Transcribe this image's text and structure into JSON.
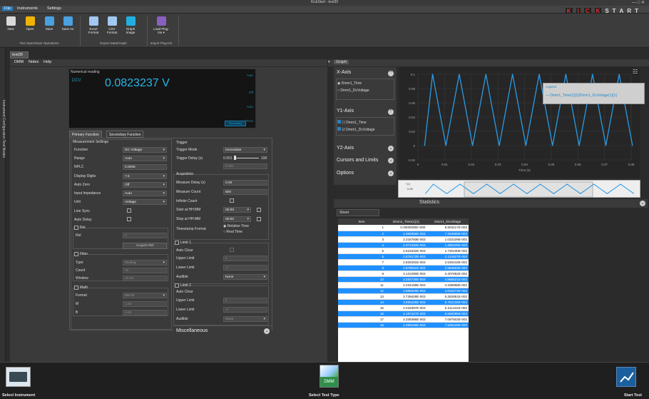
{
  "window": {
    "title": "KickStart - test30"
  },
  "menu": {
    "file": "File",
    "instruments": "Instruments",
    "settings": "Settings"
  },
  "logo": [
    "K",
    "I",
    "C",
    "K",
    "S",
    "T",
    "A",
    "R",
    "T"
  ],
  "ribbon": {
    "buttons": [
      {
        "label": "New",
        "color": "#d9d9d9"
      },
      {
        "label": "Open",
        "color": "#f0b400"
      },
      {
        "label": "Save",
        "color": "#4aa0e0"
      },
      {
        "label": "Save As",
        "color": "#4aa0e0"
      },
      {
        "label": "Excel Format",
        "color": "#a0c8f0"
      },
      {
        "label": "CSV Format",
        "color": "#a0c8f0"
      },
      {
        "label": "Graph Image",
        "color": "#20b0e0"
      },
      {
        "label": "Load Plug-Ins ▾",
        "color": "#8a5fc0"
      }
    ],
    "groups": {
      "file": "Test Open/Save Operations",
      "export": "Export Data/Graph",
      "import": "Import Plug-Ins"
    }
  },
  "side_tab": "Instrument Configuration  Test Nodes",
  "doc_tab": "test30",
  "submenu": {
    "dmm": "DMM",
    "notes": "Notes",
    "help": "Help"
  },
  "graph_tab": "Graph",
  "numerical": {
    "title": "Numerical reading",
    "func": "DCV",
    "value": "0.0823237 V",
    "labels": [
      "Auto",
      "Off",
      "Auto",
      "Trms"
    ],
    "button": "Secondary"
  },
  "tabs": {
    "primary": "Primary Function",
    "secondary": "Secondary Function"
  },
  "meas": {
    "title": "Measurement Settings",
    "function": {
      "label": "Function",
      "value": "DC Voltage"
    },
    "range": {
      "label": "Range",
      "value": "Auto"
    },
    "nplc": {
      "label": "NPLC",
      "value": "0.0005"
    },
    "digits": {
      "label": "Display Digits",
      "value": "7.5"
    },
    "autozero": {
      "label": "Auto Zero",
      "value": "Off"
    },
    "impedance": {
      "label": "Input Impedance",
      "value": "Auto"
    },
    "unit": {
      "label": "Unit",
      "value": "Voltage"
    },
    "linesync": "Line Sync",
    "autodelay": "Auto Delay",
    "rel": "Rel",
    "relfield": {
      "label": "Rel",
      "value": "0"
    },
    "acquire": "Acquire Rel",
    "filter": "Filter",
    "ftype": {
      "label": "Type",
      "value": "Moving"
    },
    "count": {
      "label": "Count",
      "value": "10"
    },
    "window": {
      "label": "Window",
      "value": "10.00"
    },
    "math": "Math",
    "format": {
      "label": "Format",
      "value": "MX+B"
    },
    "m": {
      "label": "M",
      "value": "1.00"
    },
    "b": {
      "label": "B",
      "value": "0.00"
    }
  },
  "trigger": {
    "title": "Trigger",
    "mode": {
      "label": "Trigger Mode",
      "value": "Immediate"
    },
    "delay": {
      "label": "Trigger Delay (s)",
      "value": "0.001",
      "max": "100",
      "box": "0.001"
    },
    "acq": "Acquisition",
    "measdelay": {
      "label": "Measure Delay (s)",
      "value": "0.00"
    },
    "count": {
      "label": "Measure Count",
      "value": "500"
    },
    "infinite": "Infinite Count",
    "start": {
      "label": "Start at HH:MM",
      "value": "00:00"
    },
    "stop": {
      "label": "Stop at HH:MM",
      "value": "00:00"
    },
    "tsformat": "Timestamp Format",
    "rel": "Relative Time",
    "real": "Real Time",
    "limit1": "Limit 1",
    "autoclear": "Auto Clear",
    "upper": {
      "label": "Upper Limit",
      "value": "1"
    },
    "lower": {
      "label": "Lower Limit",
      "value": "-1"
    },
    "audible": {
      "label": "Audible",
      "value": "None"
    },
    "limit2": "Limit 2",
    "autoclear2": "Auto Clear",
    "upper2": {
      "label": "Upper Limit",
      "value": "1"
    },
    "lower2": {
      "label": "Lower Limit",
      "value": "-1"
    },
    "audible2": {
      "label": "Audible",
      "value": "None"
    },
    "misc": "Miscellaneous"
  },
  "graph_side": {
    "xaxis": "X-Axis",
    "xopt1": "Dmm1_Time",
    "xopt2": "Dmm1_DcVoltage",
    "y1": "Y1-Axis",
    "y1opt1": "Dmm1_Time",
    "y1opt2": "Dmm1_DcVoltage",
    "y2": "Y2-Axis",
    "cursors": "Cursors and Limits",
    "options": "Options"
  },
  "legend": {
    "title": "Legend",
    "entry": "— Dmm1_Time(1)[1]/Dmm1_DcVoltage(1)[1]"
  },
  "chart_data": {
    "type": "line",
    "xlabel": "Time (s)",
    "ylabel": "",
    "xlim": [
      0,
      0.08
    ],
    "ylim": [
      -0.02,
      0.1
    ],
    "x_ticks": [
      "0",
      "0.01",
      "0.02",
      "0.03",
      "0.04",
      "0.05",
      "0.06",
      "0.07",
      "0.08"
    ],
    "y_ticks": [
      "0.1",
      "0.08",
      "0.06",
      "0.04",
      "0.02",
      "0",
      "-0.02"
    ],
    "series": [
      {
        "x": [
          0.0025,
          0.0055,
          0.0105,
          0.0155,
          0.0205,
          0.0255,
          0.0305,
          0.0355,
          0.0405,
          0.0455,
          0.0505,
          0.0555,
          0.0605,
          0.0655,
          0.0705,
          0.0755,
          0.0805
        ],
        "y": [
          0.0,
          0.1,
          0.0,
          0.1,
          0.0,
          0.1,
          0.0,
          0.1,
          0.0,
          0.1,
          0.0,
          0.1,
          0.0,
          0.1,
          0.0,
          0.1,
          0.0
        ],
        "color": "#2a9be6"
      }
    ],
    "grid": true
  },
  "overview": {
    "label_top": "Y(v)",
    "label_val": "0.05"
  },
  "stats": "Statistics",
  "sheet": {
    "tab": "Sheet",
    "headers": [
      "Item",
      "Dmm1_Time(1)[1]",
      "Dmm1_DcVoltage"
    ],
    "rows": [
      [
        "1",
        "0.0000000E+000",
        "8.903217E-003"
      ],
      [
        "2",
        "2.065959E-003",
        "7.263869E-002"
      ],
      [
        "3",
        "2.218793E-003",
        "1.032229E-002"
      ],
      [
        "4",
        "2.371292E-003",
        "1.390425E-002"
      ],
      [
        "5",
        "2.524532E-003",
        "1.730230E-002"
      ],
      [
        "6",
        "2.675172E-003",
        "2.114627E-002"
      ],
      [
        "7",
        "2.826291E-003",
        "2.525416E-002"
      ],
      [
        "8",
        "2.979831E-003",
        "2.953593E-002"
      ],
      [
        "9",
        "3.131290E-003",
        "3.407852E-002"
      ],
      [
        "10",
        "3.282730E-003",
        "3.866521E-002"
      ],
      [
        "11",
        "3.434189E-003",
        "4.339968E-002"
      ],
      [
        "12",
        "3.585628E-003",
        "4.816272E-002"
      ],
      [
        "13",
        "3.735628E-003",
        "5.282951E-002"
      ],
      [
        "14",
        "3.885228E-003",
        "5.752134E-002"
      ],
      [
        "15",
        "4.034087E-003",
        "6.211341E-002"
      ],
      [
        "16",
        "4.187427E-003",
        "6.668395E-002"
      ],
      [
        "17",
        "4.339386E-003",
        "7.097503E-002"
      ],
      [
        "18",
        "4.488166E-003",
        "7.506429E-002"
      ]
    ]
  },
  "bottom": {
    "select_instrument": "Select Instrument",
    "dmm": "DMM",
    "select_test": "Select Test Type",
    "start": "Start Test"
  }
}
